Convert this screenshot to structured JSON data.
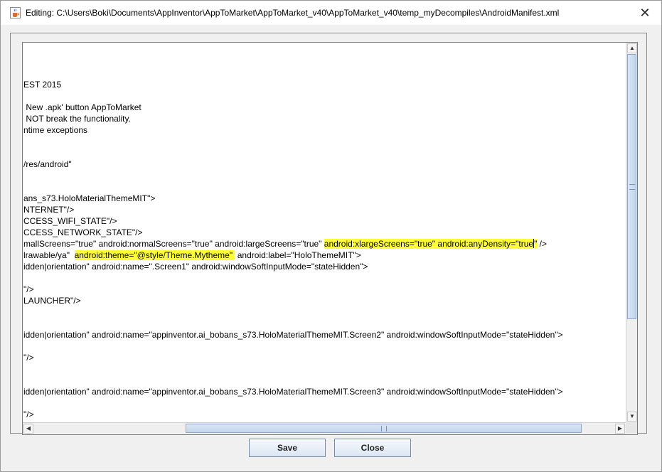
{
  "window": {
    "title": "Editing: C:\\Users\\Boki\\Documents\\AppInventor\\AppToMarket\\AppToMarket_v40\\AppToMarket_v40\\temp_myDecompiles\\AndroidManifest.xml",
    "close_glyph": "✕"
  },
  "editor": {
    "lines": [
      {
        "row": 3,
        "text": "EST 2015"
      },
      {
        "row": 5,
        "text": " New .apk' button AppToMarket"
      },
      {
        "row": 6,
        "text": " NOT break the functionality."
      },
      {
        "row": 7,
        "text": "ntime exceptions"
      },
      {
        "row": 10,
        "text": "/res/android\""
      },
      {
        "row": 13,
        "text": "ans_s73.HoloMaterialThemeMIT\">"
      },
      {
        "row": 14,
        "text": "NTERNET\"/>"
      },
      {
        "row": 15,
        "text": "CCESS_WIFI_STATE\"/>"
      },
      {
        "row": 16,
        "text": "CCESS_NETWORK_STATE\"/>"
      },
      {
        "row": 17,
        "segments": [
          {
            "text": "mallScreens=\"true\" android:normalScreens=\"true\" android:largeScreens=\"true\" ",
            "hl": false
          },
          {
            "text": "android:xlargeScreens=\"true\" android:anyDensity=\"true",
            "hl": true
          },
          {
            "text": "CARET",
            "hl": true
          },
          {
            "text": "\"",
            "hl": true
          },
          {
            "text": " />",
            "hl": false
          }
        ]
      },
      {
        "row": 18,
        "segments": [
          {
            "text": "lrawable/ya\"  ",
            "hl": false
          },
          {
            "text": "android:theme=\"@style/Theme.Mytheme\" ",
            "hl": true
          },
          {
            "text": " android:label=\"HoloThemeMIT\">",
            "hl": false
          }
        ]
      },
      {
        "row": 19,
        "text": "idden|orientation\" android:name=\".Screen1\" android:windowSoftInputMode=\"stateHidden\">"
      },
      {
        "row": 21,
        "text": "\"/>"
      },
      {
        "row": 22,
        "text": "LAUNCHER\"/>"
      },
      {
        "row": 25,
        "text": "idden|orientation\" android:name=\"appinventor.ai_bobans_s73.HoloMaterialThemeMIT.Screen2\" android:windowSoftInputMode=\"stateHidden\">"
      },
      {
        "row": 27,
        "text": "\"/>"
      },
      {
        "row": 30,
        "text": "idden|orientation\" android:name=\"appinventor.ai_bobans_s73.HoloMaterialThemeMIT.Screen3\" android:windowSoftInputMode=\"stateHidden\">"
      },
      {
        "row": 32,
        "text": "\"/>"
      }
    ]
  },
  "buttons": {
    "save_label": "Save",
    "close_label": "Close"
  },
  "colors": {
    "highlight": "#ffff33",
    "button_border": "#7a8ea8",
    "scroll_thumb": "#c3d6ec"
  },
  "icons": {
    "app": "java-coffee-cup-icon",
    "up": "▲",
    "down": "▼",
    "left": "◀",
    "right": "▶"
  }
}
